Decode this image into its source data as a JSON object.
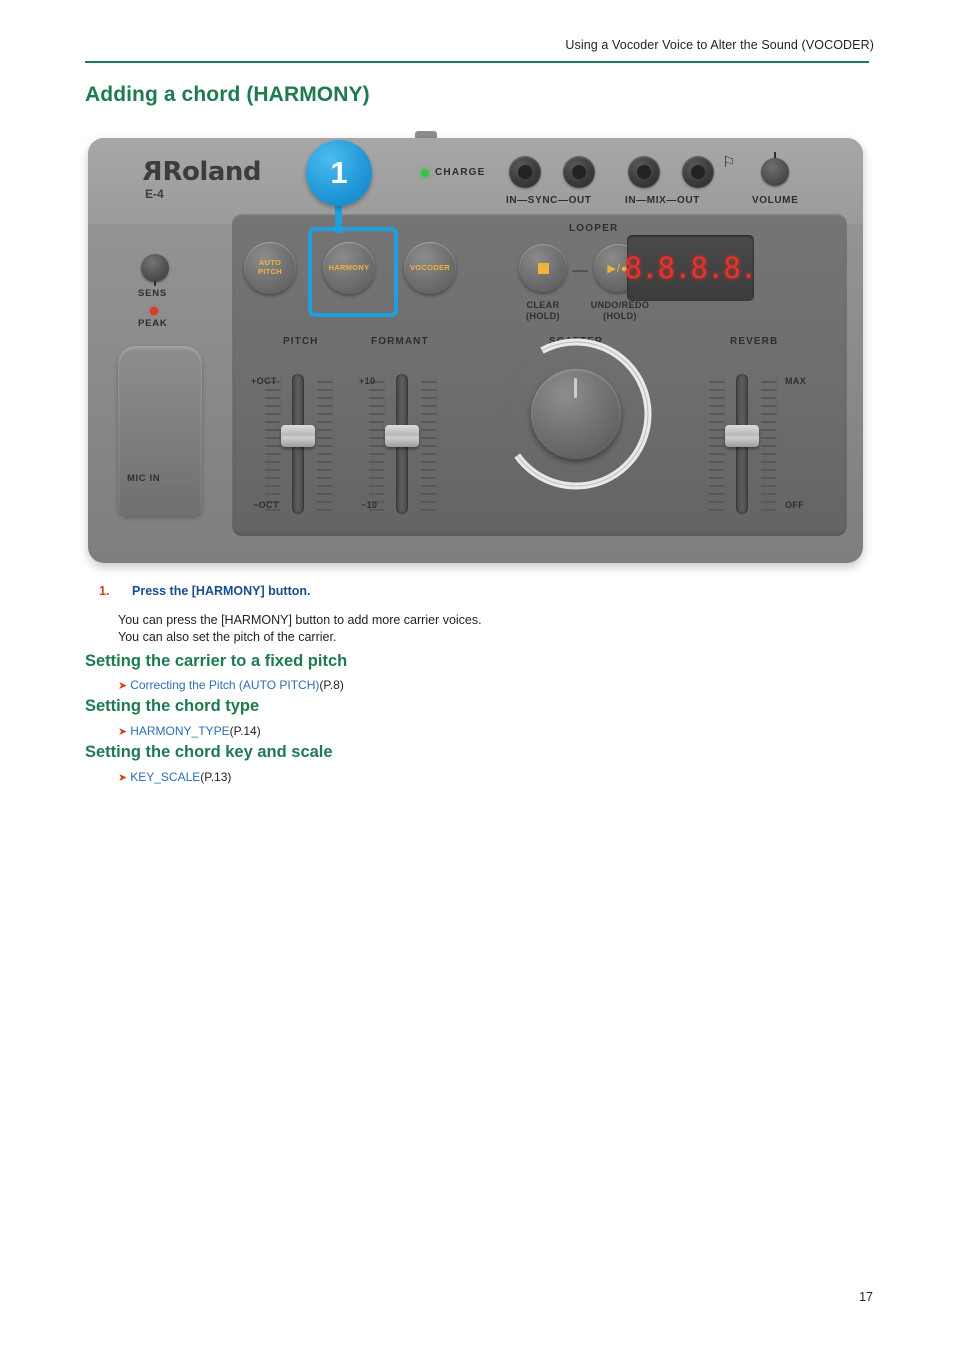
{
  "header": {
    "running_title": "Using a Vocoder Voice to Alter the Sound (VOCODER)"
  },
  "page_title": "Adding a chord (HARMONY)",
  "device": {
    "brand": "Roland",
    "model": "E-4",
    "charge_label": "CHARGE",
    "jacks": {
      "sync_label": "IN—SYNC—OUT",
      "mix_label": "IN—MIX—OUT",
      "volume_label": "VOLUME",
      "headphone_icon": "headphone-icon"
    },
    "buttons": {
      "auto_pitch": "AUTO\nPITCH",
      "auto_pitch_line1": "AUTO",
      "auto_pitch_line2": "PITCH",
      "harmony": "HARMONY",
      "vocoder": "VOCODER"
    },
    "callout": {
      "number": "1"
    },
    "sens_label": "SENS",
    "peak_label": "PEAK",
    "mic_label": "MIC IN",
    "looper": {
      "title": "LOOPER",
      "clear_line1": "CLEAR",
      "clear_line2": "(HOLD)",
      "undo_line1": "UNDO/REDO",
      "undo_line2": "(HOLD)",
      "stop_icon": "stop-square-icon",
      "play_rec_icon": "play-record-icon"
    },
    "display": {
      "digits": "8.8.8.8."
    },
    "sections": {
      "pitch": "PITCH",
      "formant": "FORMANT",
      "scatter": "SCATTER",
      "reverb": "REVERB"
    },
    "scale_labels": {
      "pitch_top": "+OCT",
      "pitch_bottom": "−OCT",
      "formant_top": "+10",
      "formant_bottom": "−10",
      "reverb_top": "MAX",
      "reverb_bottom": "OFF"
    }
  },
  "step": {
    "number": "1.",
    "text": "Press the [HARMONY] button."
  },
  "body": {
    "line1": "You can press the [HARMONY] button to add more carrier voices.",
    "line2": "You can also set the pitch of the carrier."
  },
  "sections": [
    {
      "heading": "Setting the carrier to a fixed pitch",
      "link_text": "Correcting the Pitch (AUTO PITCH)",
      "link_suffix": "(P.8)"
    },
    {
      "heading": "Setting the chord type",
      "link_text": "HARMONY_TYPE",
      "link_suffix": "(P.14)"
    },
    {
      "heading": "Setting the chord key and scale",
      "link_text": "KEY_SCALE",
      "link_suffix": "(P.13)"
    }
  ],
  "footer": {
    "page_number": "17"
  },
  "colors": {
    "accent_green": "#1e7a4f",
    "link_blue": "#2a6fb5",
    "step_blue": "#1b4b8f",
    "arrow_orange": "#d2431d",
    "callout_blue": "#1f9ee0"
  }
}
